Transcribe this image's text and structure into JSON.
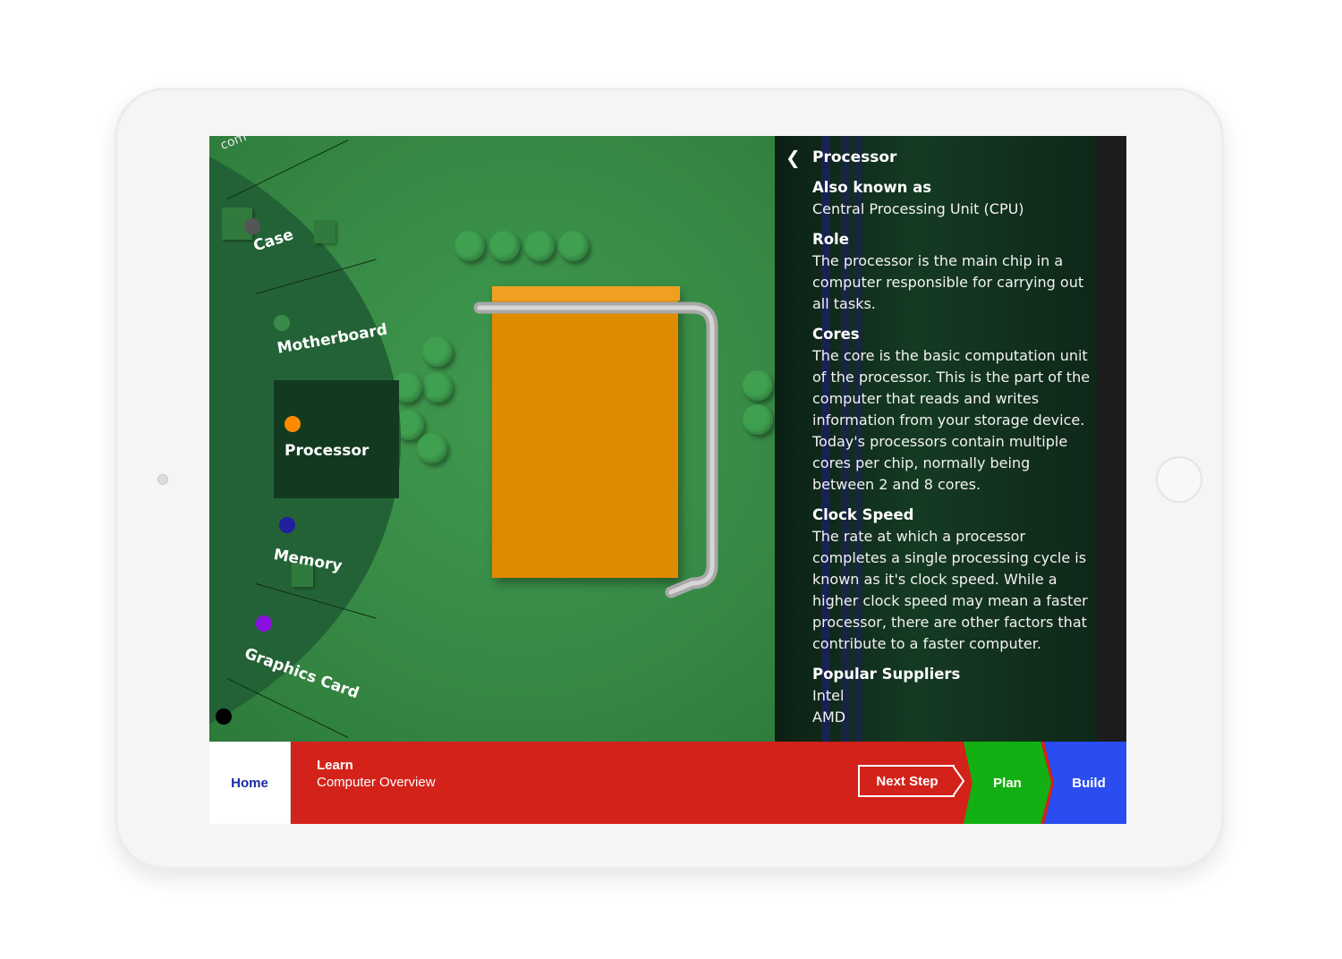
{
  "wheel": {
    "partial_label": "com",
    "items": [
      {
        "label": "Case",
        "color": "#555555"
      },
      {
        "label": "Motherboard",
        "color": "#3a8a4a"
      },
      {
        "label": "Processor",
        "color": "#ff8a00"
      },
      {
        "label": "Memory",
        "color": "#1f1fa0"
      },
      {
        "label": "Graphics Card",
        "color": "#8a10e0"
      },
      {
        "label": "",
        "color": "#000000"
      }
    ],
    "selected": "Processor"
  },
  "panel": {
    "back_icon": "chevron-left-icon",
    "title": "Processor",
    "sections": [
      {
        "heading": "Also known as",
        "body": "Central Processing Unit (CPU)"
      },
      {
        "heading": "Role",
        "body": "The processor is the main chip in a computer responsible for carrying out all tasks."
      },
      {
        "heading": "Cores",
        "body": "The core is the basic computation unit of the processor. This is the part of the computer that reads and writes information from your storage device. Today's processors contain multiple cores per chip, normally being between 2 and 8 cores."
      },
      {
        "heading": "Clock Speed",
        "body": "The rate at which a processor completes a single processing cycle is known as it's clock speed.  While a higher clock speed may mean a faster processor, there are other factors that contribute to a faster computer."
      },
      {
        "heading": "Popular Suppliers",
        "body_lines": [
          "Intel",
          "AMD"
        ]
      }
    ]
  },
  "bottom_bar": {
    "home_label": "Home",
    "crumb_section": "Learn",
    "crumb_page": "Computer Overview",
    "next_step_label": "Next Step",
    "plan_label": "Plan",
    "build_label": "Build",
    "colors": {
      "learn": "#d3221a",
      "plan": "#12b012",
      "build": "#2a4cf0",
      "home_text": "#1a2aa0"
    }
  }
}
